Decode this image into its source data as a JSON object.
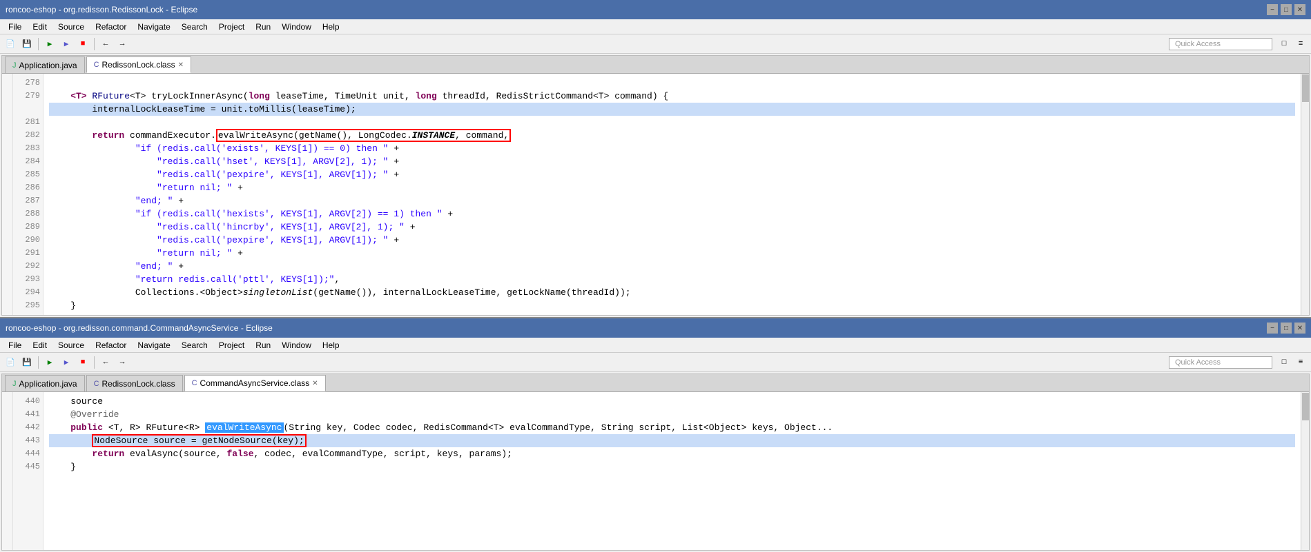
{
  "window1": {
    "title": "roncoo-eshop - org.redisson.RedissonLock - Eclipse",
    "menu": [
      "File",
      "Edit",
      "Source",
      "Refactor",
      "Navigate",
      "Search",
      "Project",
      "Run",
      "Window",
      "Help"
    ],
    "quickAccess": "Quick Access",
    "tabs": [
      {
        "label": "Application.java",
        "icon": "J",
        "active": false
      },
      {
        "label": "RedissonLock.class",
        "icon": "C",
        "active": true,
        "closeable": true
      }
    ],
    "lines": [
      {
        "num": "278",
        "mark": "",
        "code": ""
      },
      {
        "num": "279",
        "mark": "◈",
        "code": "    <T> RFuture<T> tryLockInnerAsync(long leaseTime, TimeUnit unit, long threadId, RedisStrictCommand<T> command) {"
      },
      {
        "num": "",
        "mark": "▶",
        "code": "        internalLockLeaseTime = unit.toMillis(leaseTime);"
      },
      {
        "num": "281",
        "mark": "",
        "code": ""
      },
      {
        "num": "282",
        "mark": "",
        "code": "        return commandExecutor.evalWriteAsync(getName(), LongCodec.INSTANCE, command,"
      },
      {
        "num": "283",
        "mark": "",
        "code": "                \"if (redis.call('exists', KEYS[1]) == 0) then \" +"
      },
      {
        "num": "284",
        "mark": "",
        "code": "                    \"redis.call('hset', KEYS[1], ARGV[2], 1); \" +"
      },
      {
        "num": "285",
        "mark": "",
        "code": "                    \"redis.call('pexpire', KEYS[1], ARGV[1]); \" +"
      },
      {
        "num": "286",
        "mark": "",
        "code": "                    \"return nil; \" +"
      },
      {
        "num": "287",
        "mark": "",
        "code": "                \"end; \" +"
      },
      {
        "num": "288",
        "mark": "",
        "code": "                \"if (redis.call('hexists', KEYS[1], ARGV[2]) == 1) then \" +"
      },
      {
        "num": "289",
        "mark": "",
        "code": "                    \"redis.call('hincrby', KEYS[1], ARGV[2], 1); \" +"
      },
      {
        "num": "290",
        "mark": "",
        "code": "                    \"redis.call('pexpire', KEYS[1], ARGV[1]); \" +"
      },
      {
        "num": "291",
        "mark": "",
        "code": "                    \"return nil; \" +"
      },
      {
        "num": "292",
        "mark": "",
        "code": "                \"end; \" +"
      },
      {
        "num": "293",
        "mark": "",
        "code": "                \"return redis.call('pttl', KEYS[1]);\","
      },
      {
        "num": "294",
        "mark": "",
        "code": "                Collections.<Object>singletonList(getName()), internalLockLeaseTime, getLockName(threadId));"
      },
      {
        "num": "295",
        "mark": "",
        "code": "    }"
      }
    ]
  },
  "window2": {
    "title": "roncoo-eshop - org.redisson.command.CommandAsyncService - Eclipse",
    "menu": [
      "File",
      "Edit",
      "Source",
      "Refactor",
      "Navigate",
      "Search",
      "Project",
      "Run",
      "Window",
      "Help"
    ],
    "quickAccess": "Quick Access",
    "tabs": [
      {
        "label": "Application.java",
        "icon": "J",
        "active": false
      },
      {
        "label": "RedissonLock.class",
        "icon": "C",
        "active": false
      },
      {
        "label": "CommandAsyncService.class",
        "icon": "C",
        "active": true,
        "closeable": true
      }
    ],
    "lines": [
      {
        "num": "440",
        "mark": "",
        "code": "    source"
      },
      {
        "num": "441",
        "mark": "◈",
        "code": "    @Override"
      },
      {
        "num": "442",
        "mark": "",
        "code": "    public <T, R> RFuture<R> evalWriteAsync(String key, Codec codec, RedisCommand<T> evalCommandType, String script, List<Object> keys, Object..."
      },
      {
        "num": "443",
        "mark": "▶",
        "code": "        NodeSource source = getNodeSource(key);"
      },
      {
        "num": "444",
        "mark": "",
        "code": "        return evalAsync(source, false, codec, evalCommandType, script, keys, params);"
      },
      {
        "num": "445",
        "mark": "",
        "code": "    }"
      }
    ]
  }
}
